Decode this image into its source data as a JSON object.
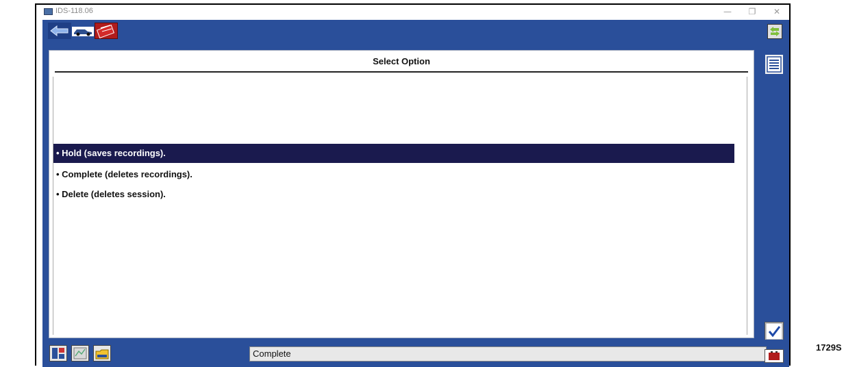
{
  "window": {
    "title": "IDS-118.06",
    "minimize_glyph": "—",
    "restore_glyph": "❐",
    "close_glyph": "✕"
  },
  "toolbar": {
    "icons": [
      "back-arrow-icon",
      "vehicle-icon",
      "toolbox-icon",
      "swap-arrows-icon"
    ]
  },
  "panel": {
    "title": "Select Option",
    "options": [
      {
        "label": "• Hold (saves recordings).",
        "selected": true
      },
      {
        "label": "• Complete (deletes recordings).",
        "selected": false
      },
      {
        "label": "• Delete (deletes session).",
        "selected": false
      }
    ]
  },
  "sidebar": {
    "icons": [
      "list-icon",
      "checkmark-icon"
    ]
  },
  "statusbar": {
    "icons": [
      "dashboard-icon",
      "map-icon",
      "folder-icon",
      "battery-icon"
    ],
    "status_text": "Complete"
  },
  "figure_id": "1729S",
  "colors": {
    "app_blue": "#2a4f9a",
    "selection": "#1a1a4e",
    "toolbox_red": "#b01c1c"
  }
}
